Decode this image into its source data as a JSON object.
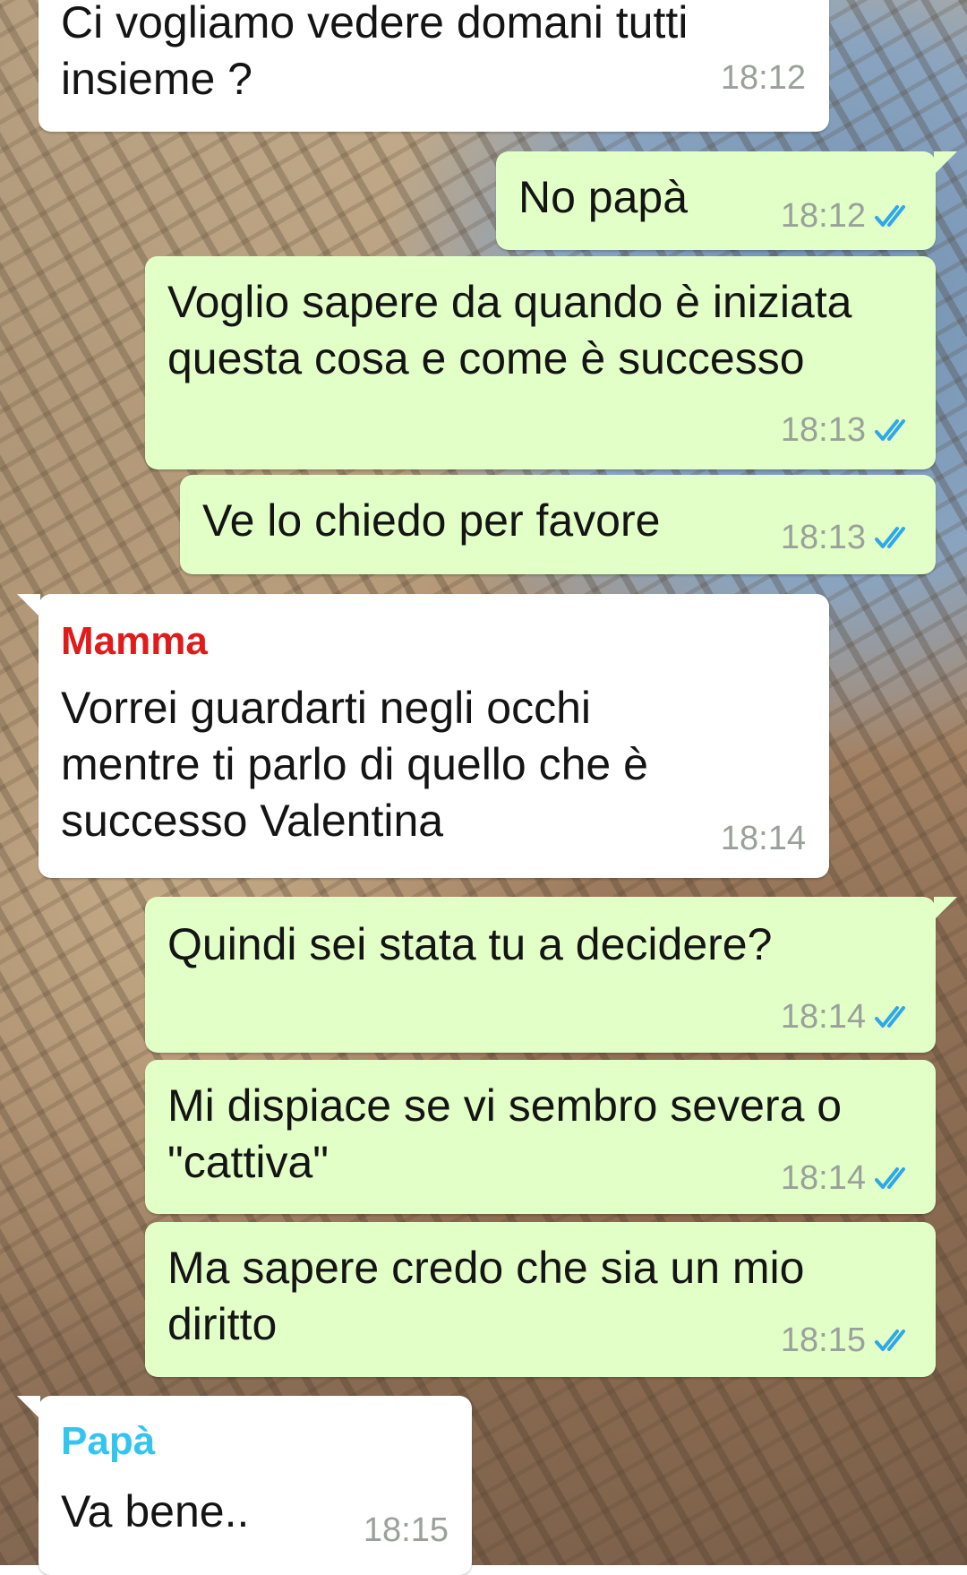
{
  "colors": {
    "incoming_bubble": "#ffffff",
    "outgoing_bubble": "#e2ffc7",
    "read_ticks": "#2fa7e8",
    "sender_mamma": "#e11b1b",
    "sender_papa": "#34c5ef"
  },
  "messages": [
    {
      "direction": "incoming",
      "sender": "",
      "text": "Ci vogliamo vedere domani tutti\ninsieme ?",
      "time": "18:12"
    },
    {
      "direction": "outgoing",
      "text": "No papà",
      "time": "18:12",
      "status": "read"
    },
    {
      "direction": "outgoing",
      "text": "Voglio sapere da quando è iniziata\nquesta cosa e come è successo",
      "time": "18:13",
      "status": "read"
    },
    {
      "direction": "outgoing",
      "text": "Ve lo chiedo per favore",
      "time": "18:13",
      "status": "read"
    },
    {
      "direction": "incoming",
      "sender": "Mamma",
      "text": "Vorrei guardarti negli occhi\nmentre ti parlo di quello che è\nsuccesso Valentina",
      "time": "18:14"
    },
    {
      "direction": "outgoing",
      "text": "Quindi sei stata tu a decidere?",
      "time": "18:14",
      "status": "read"
    },
    {
      "direction": "outgoing",
      "text": "Mi dispiace se vi sembro severa o\n\"cattiva\"",
      "time": "18:14",
      "status": "read"
    },
    {
      "direction": "outgoing",
      "text": "Ma sapere credo che sia un mio\ndiritto",
      "time": "18:15",
      "status": "read"
    },
    {
      "direction": "incoming",
      "sender": "Papà",
      "text": "Va bene..",
      "time": "18:15"
    }
  ]
}
